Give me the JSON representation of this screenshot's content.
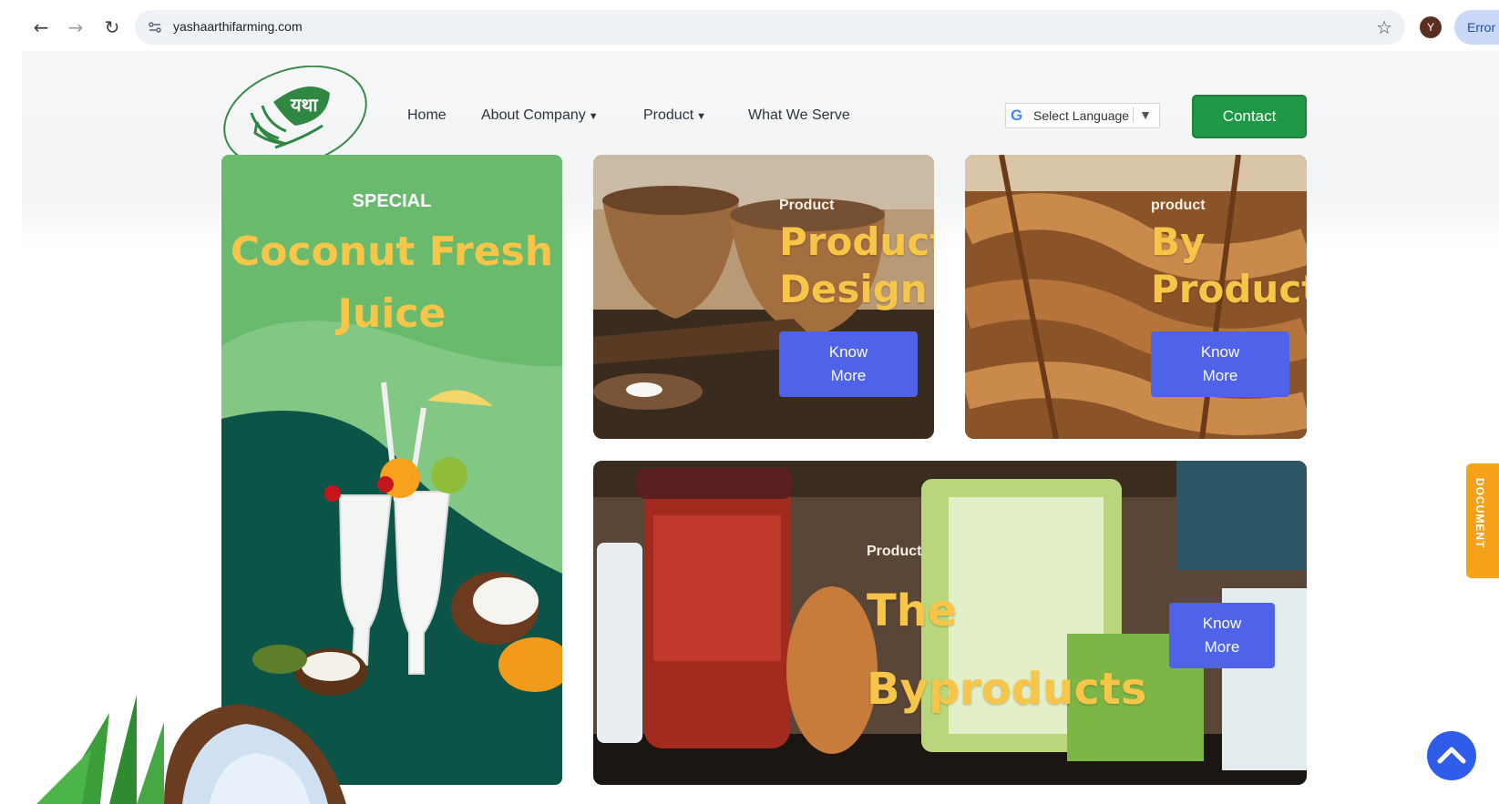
{
  "browser": {
    "url": "yashaarthifarming.com",
    "profile_initial": "Y",
    "error_label": "Error"
  },
  "nav": {
    "home": "Home",
    "about": "About Company",
    "product": "Product",
    "what_we_serve": "What We Serve",
    "language": "Select Language",
    "contact": "Contact"
  },
  "logo": {
    "text": "यथा"
  },
  "cards": {
    "special": {
      "label": "SPECIAL",
      "title_line1": "Coconut Fresh",
      "title_line2": "Juice"
    },
    "product_design": {
      "eyebrow": "Product",
      "title_line1": "Product",
      "title_line2": "Design",
      "button_line1": "Know",
      "button_line2": "More"
    },
    "by_product": {
      "eyebrow": "product",
      "title_line1": "By",
      "title_line2": "Product",
      "button_line1": "Know",
      "button_line2": "More"
    },
    "byproducts": {
      "eyebrow": "Product",
      "title_line1": "The",
      "title_line2": "Byproducts",
      "button_line1": "Know",
      "button_line2": "More"
    }
  },
  "side_tab": {
    "label": "DOCUMENT"
  },
  "colors": {
    "contact_green": "#1e9845",
    "button_blue": "#4f63e8",
    "title_yellow": "#f7c548",
    "special_green": "#6aba6d",
    "doc_orange": "#f5a11a"
  }
}
